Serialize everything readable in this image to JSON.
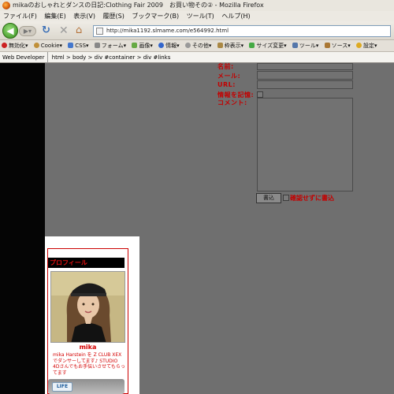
{
  "window": {
    "title": "mikaのおしゃれとダンスの日記:Clothing Fair 2009　お買い物その② - Mozilla Firefox"
  },
  "menu": [
    "ファイル(F)",
    "編集(E)",
    "表示(V)",
    "履歴(S)",
    "ブックマーク(B)",
    "ツール(T)",
    "ヘルプ(H)"
  ],
  "address": {
    "url": "http://mika1192.slmame.com/e564992.html"
  },
  "webdev_toolbar": [
    {
      "label": "無効化▾",
      "color": "#cc2222"
    },
    {
      "label": "Cookie▾",
      "color": "#c0903a"
    },
    {
      "label": "CSS▾",
      "color": "#4477cc"
    },
    {
      "label": "フォーム▾",
      "color": "#888888"
    },
    {
      "label": "画像▾",
      "color": "#66aa44"
    },
    {
      "label": "情報▾",
      "color": "#3366cc"
    },
    {
      "label": "その他▾",
      "color": "#999999"
    },
    {
      "label": "枠表示▾",
      "color": "#aa8844"
    },
    {
      "label": "サイズ変更▾",
      "color": "#44aa44"
    },
    {
      "label": "ツール▾",
      "color": "#5577aa"
    },
    {
      "label": "ソース▾",
      "color": "#aa7733"
    },
    {
      "label": "設定▾",
      "color": "#ddaa22"
    }
  ],
  "breadcrumb": {
    "label": "Web Developer",
    "path": "html > body > div #container > div #links"
  },
  "comment_form": {
    "name_label": "名前:",
    "mail_label": "メール:",
    "url_label": "URL:",
    "remember_label": "情報を記憶:",
    "comment_label": "コメント:",
    "submit_label": "書込",
    "confirm_label": "確認せずに書込"
  },
  "profile": {
    "heading": "プロフィール",
    "name": "mika",
    "description": "mika Harstein を Z CLUB XEXでダンサーしてます♪ STUDIO 4Dさんでもお手伝いさせてもらってます",
    "banner_text": "LIFE"
  }
}
